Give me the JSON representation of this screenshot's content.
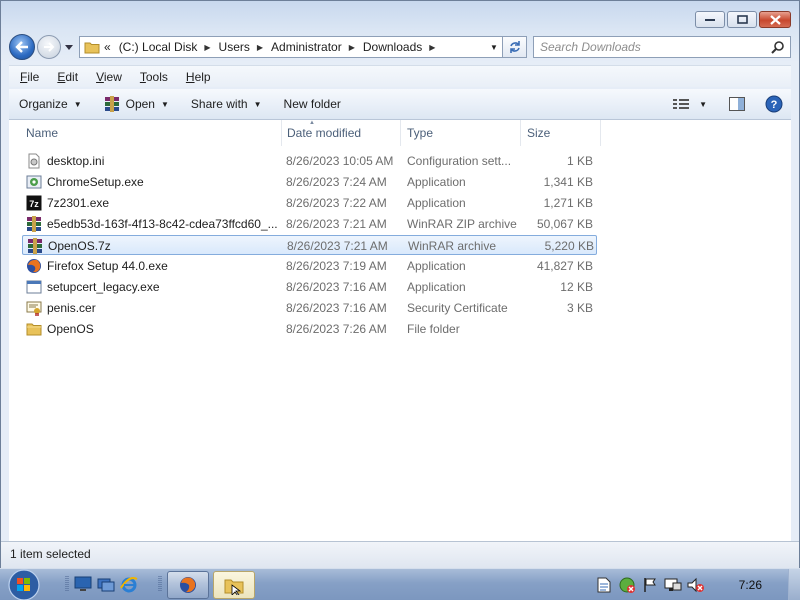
{
  "window": {
    "title": "Downloads"
  },
  "nav": {
    "breadcrumb_prefix": "«",
    "crumbs": [
      "(C:) Local Disk",
      "Users",
      "Administrator",
      "Downloads"
    ]
  },
  "search": {
    "placeholder": "Search Downloads"
  },
  "menu": {
    "file": {
      "key": "F",
      "rest": "ile"
    },
    "edit": {
      "key": "E",
      "rest": "dit"
    },
    "view": {
      "key": "V",
      "rest": "iew"
    },
    "tools": {
      "key": "T",
      "rest": "ools"
    },
    "help": {
      "key": "H",
      "rest": "elp"
    }
  },
  "toolbar": {
    "organize": "Organize",
    "open": "Open",
    "share_with": "Share with",
    "new_folder": "New folder"
  },
  "columns": {
    "name": "Name",
    "date": "Date modified",
    "type": "Type",
    "size": "Size"
  },
  "files": [
    {
      "name": "desktop.ini",
      "date": "8/26/2023 10:05 AM",
      "type": "Configuration sett...",
      "size": "1 KB",
      "icon": "settings-file-icon"
    },
    {
      "name": "ChromeSetup.exe",
      "date": "8/26/2023 7:24 AM",
      "type": "Application",
      "size": "1,341 KB",
      "icon": "installer-icon"
    },
    {
      "name": "7z2301.exe",
      "date": "8/26/2023 7:22 AM",
      "type": "Application",
      "size": "1,271 KB",
      "icon": "7zip-icon"
    },
    {
      "name": "e5edb53d-163f-4f13-8c42-cdea73ffcd60_...",
      "date": "8/26/2023 7:21 AM",
      "type": "WinRAR ZIP archive",
      "size": "50,067 KB",
      "icon": "winrar-zip-icon"
    },
    {
      "name": "OpenOS.7z",
      "date": "8/26/2023 7:21 AM",
      "type": "WinRAR archive",
      "size": "5,220 KB",
      "icon": "winrar-archive-icon",
      "selected": true
    },
    {
      "name": "Firefox Setup 44.0.exe",
      "date": "8/26/2023 7:19 AM",
      "type": "Application",
      "size": "41,827 KB",
      "icon": "firefox-installer-icon"
    },
    {
      "name": "setupcert_legacy.exe",
      "date": "8/26/2023 7:16 AM",
      "type": "Application",
      "size": "12 KB",
      "icon": "application-icon"
    },
    {
      "name": "penis.cer",
      "date": "8/26/2023 7:16 AM",
      "type": "Security Certificate",
      "size": "3 KB",
      "icon": "certificate-icon"
    },
    {
      "name": "OpenOS",
      "date": "8/26/2023 7:26 AM",
      "type": "File folder",
      "size": "",
      "icon": "folder-icon"
    }
  ],
  "status": {
    "text": "1 item selected"
  },
  "taskbar": {
    "clock": "7:26"
  },
  "colors": {
    "selection_border": "#84acdd",
    "selection_fill": "#d9e9fc",
    "close_button": "#c8482e",
    "header_text": "#4c607a"
  }
}
